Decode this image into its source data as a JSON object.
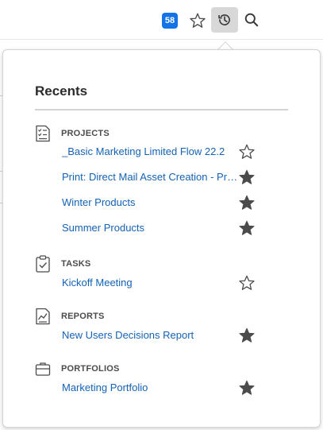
{
  "topbar": {
    "badge_count": "58"
  },
  "recents": {
    "title": "Recents",
    "sections": [
      {
        "label": "PROJECTS",
        "icon": "project-checklist-icon",
        "items": [
          {
            "label": "_Basic Marketing Limited Flow 22.2",
            "favorite": false
          },
          {
            "label": "Print: Direct Mail Asset Creation - Pro...",
            "favorite": true
          },
          {
            "label": "Winter Products",
            "favorite": true
          },
          {
            "label": "Summer Products",
            "favorite": true
          }
        ]
      },
      {
        "label": "TASKS",
        "icon": "task-clipboard-icon",
        "items": [
          {
            "label": "Kickoff Meeting",
            "favorite": false
          }
        ]
      },
      {
        "label": "REPORTS",
        "icon": "report-chart-icon",
        "items": [
          {
            "label": "New Users Decisions Report",
            "favorite": true
          }
        ]
      },
      {
        "label": "PORTFOLIOS",
        "icon": "portfolio-briefcase-icon",
        "items": [
          {
            "label": "Marketing Portfolio",
            "favorite": true
          }
        ]
      }
    ]
  },
  "colors": {
    "accent": "#1473e6",
    "link": "#1462b5",
    "star_filled": "#4b4b4b"
  }
}
